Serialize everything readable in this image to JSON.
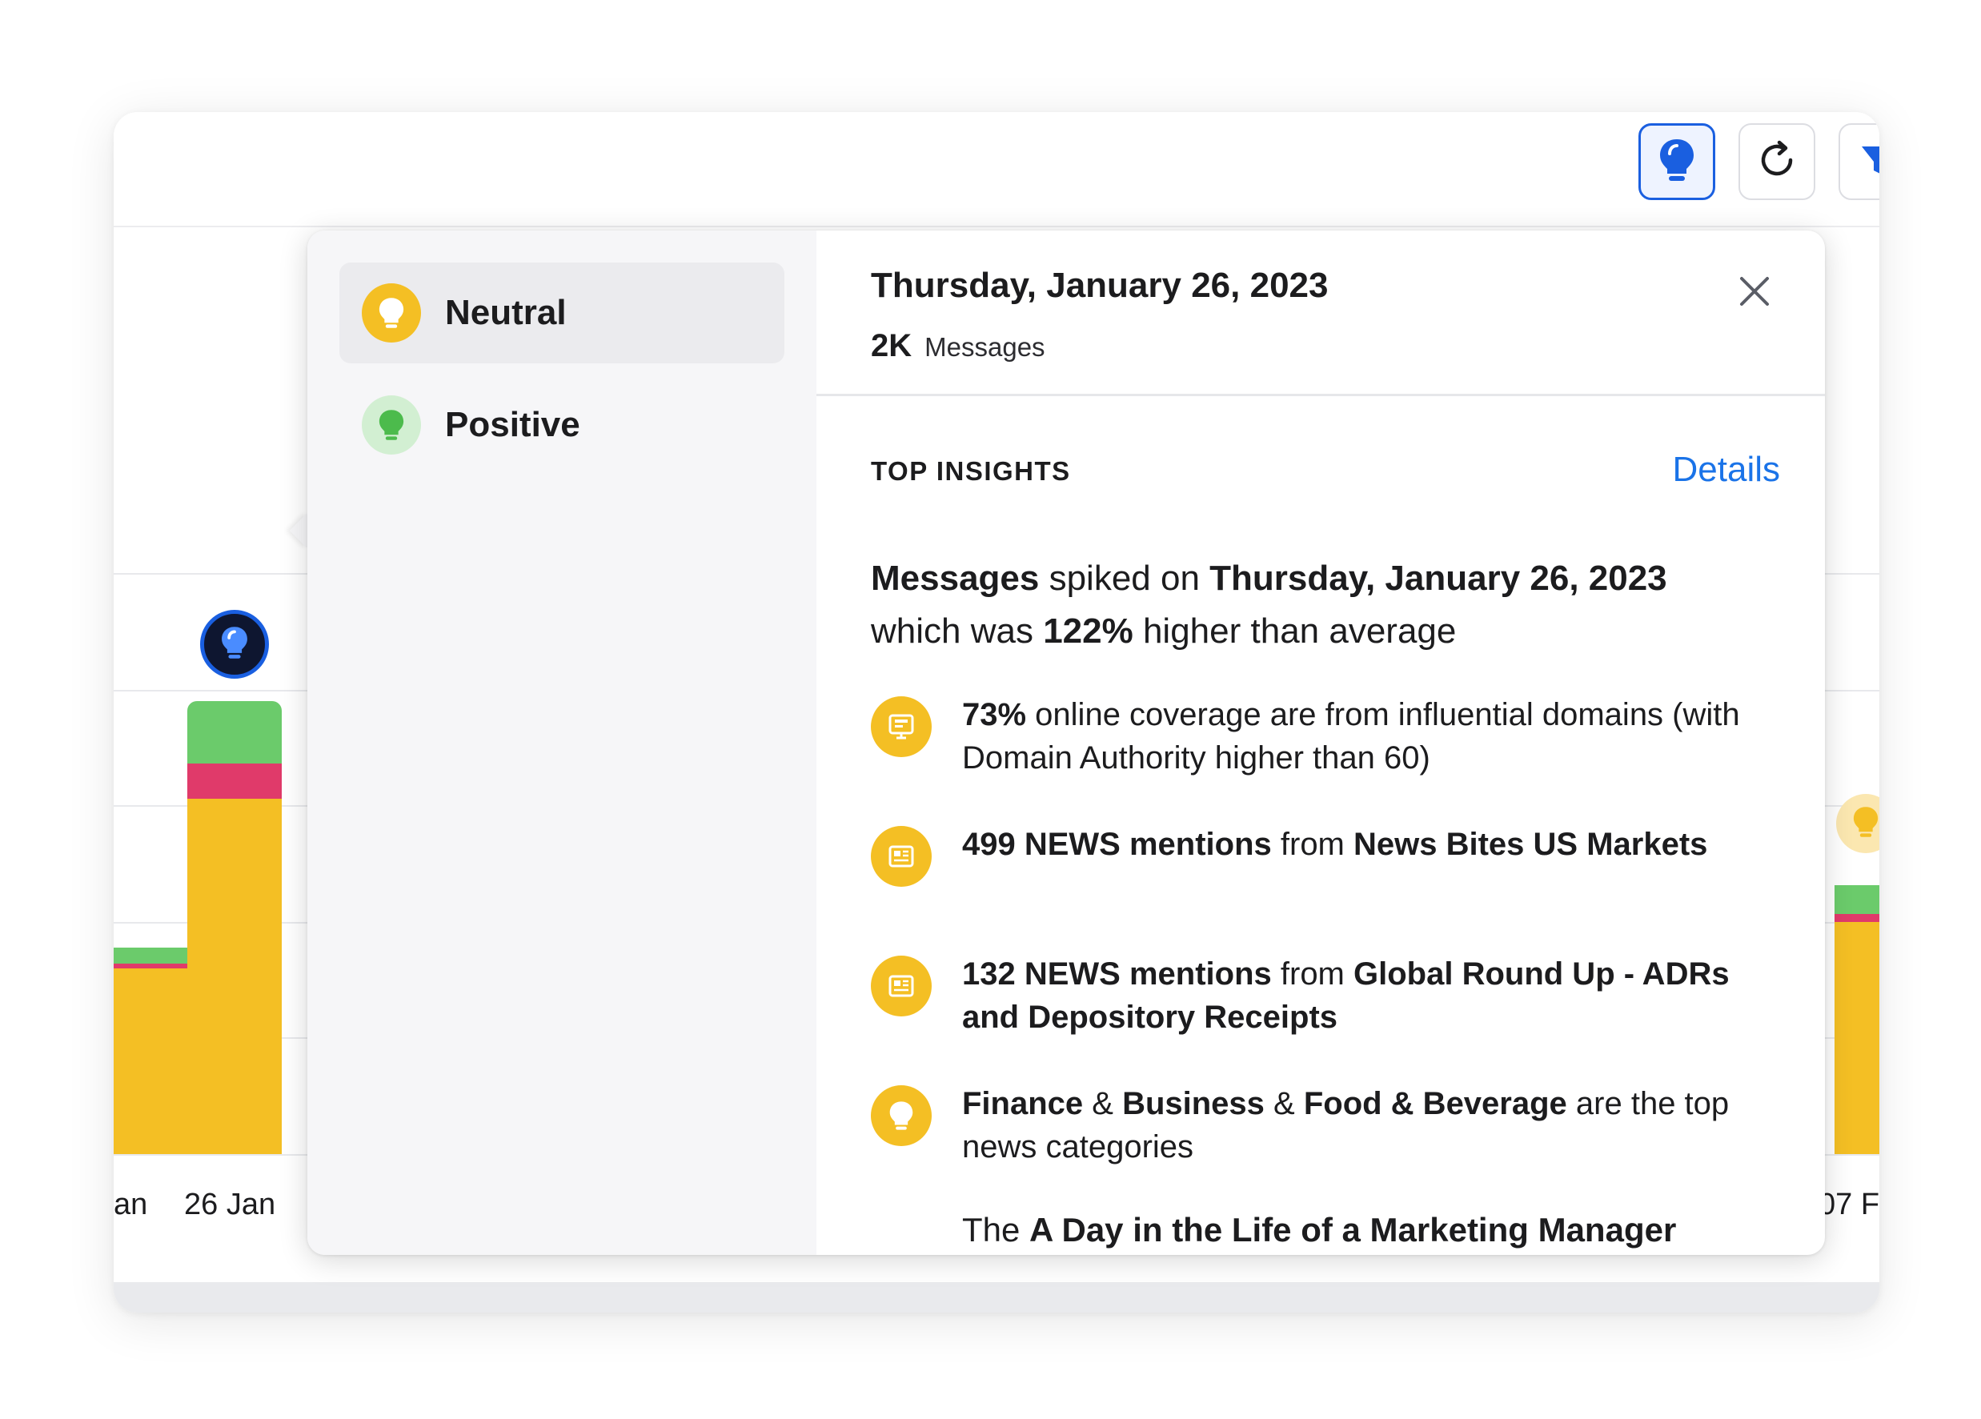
{
  "toolbar": {
    "insights_icon": "lightbulb-icon",
    "refresh_icon": "refresh-icon",
    "filter_icon": "filter-icon"
  },
  "chart": {
    "x_labels": [
      "an",
      "26 Jan",
      "07 F"
    ],
    "colors": {
      "positive": "#6bcb6b",
      "negative": "#e03a6a",
      "neutral": "#f4bf24",
      "accent": "#1a5fe0"
    }
  },
  "popover": {
    "sidebar": {
      "items": [
        {
          "label": "Neutral",
          "icon": "lightbulb-icon",
          "color": "#f4bf24",
          "selected": true
        },
        {
          "label": "Positive",
          "icon": "lightbulb-icon",
          "color": "#6bcb6b",
          "selected": false
        }
      ]
    },
    "header": {
      "date": "Thursday, January 26, 2023",
      "count": "2K",
      "count_unit": "Messages"
    },
    "section_title": "TOP INSIGHTS",
    "details_label": "Details",
    "summary": {
      "p1": "Messages",
      "p2": " spiked on ",
      "p3": "Thursday, January 26, 2023",
      "p4": " which was ",
      "p5": "122%",
      "p6": " higher than average"
    },
    "insights": [
      {
        "icon": "online-coverage-icon",
        "t1": "73%",
        "t2": " online coverage are from influential domains (with Domain Authority higher than 60)"
      },
      {
        "icon": "newspaper-icon",
        "t1": "499 NEWS mentions",
        "t2": " from ",
        "t3": "News Bites US Markets"
      },
      {
        "icon": "newspaper-icon",
        "t1": "132 NEWS mentions",
        "t2": " from ",
        "t3": "Global Round Up - ADRs and Depository Receipts"
      },
      {
        "icon": "lightbulb-icon",
        "t1": "Finance",
        "t2": " & ",
        "t3": "Business",
        "t4": " & ",
        "t5": "Food & Beverage",
        "t6": " are the top news categories"
      }
    ],
    "partial_insight": {
      "t1": "The ",
      "t2": "A Day in the Life of a Marketing Manager"
    }
  }
}
